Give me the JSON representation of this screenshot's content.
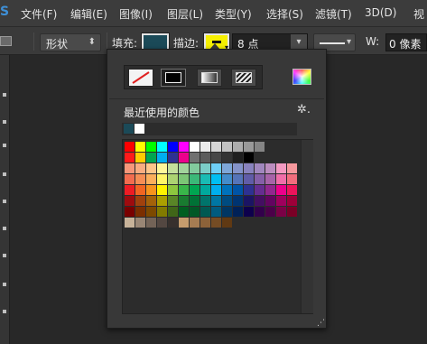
{
  "menubar": {
    "logo_glyph": "S",
    "items": [
      "文件(F)",
      "编辑(E)",
      "图像(I)",
      "图层(L)",
      "类型(Y)",
      "选择(S)",
      "滤镜(T)",
      "3D(D)",
      "视"
    ]
  },
  "options": {
    "shape_mode": "形状",
    "fill_label": "填充:",
    "fill_color": "#1b4a58",
    "stroke_label": "描边:",
    "stroke_color": "#f6f000",
    "stroke_size": "8 点",
    "width_label": "W:",
    "width_value": "0 像素"
  },
  "popup": {
    "type_icons": [
      "no-color-icon",
      "solid-color-icon",
      "gradient-icon",
      "pattern-icon"
    ],
    "active_type": "solid-color",
    "recent_title": "最近使用的颜色",
    "gear_glyph": "✲.",
    "grip_glyph": "⋰",
    "recent_colors": [
      "#1b4a58",
      "#ffffff"
    ],
    "swatch_rows": [
      [
        "#ff0000",
        "#ffff00",
        "#00ff00",
        "#00ffff",
        "#0000ff",
        "#ff00ff",
        "#ffffff",
        "#ebebeb",
        "#d6d6d6",
        "#c2c2c2",
        "#adadad",
        "#999999",
        "#858585"
      ],
      [
        "#ff1a1a",
        "#ffcc00",
        "#00a651",
        "#00aeef",
        "#2e3192",
        "#ec008c",
        "#707070",
        "#5c5c5c",
        "#474747",
        "#333333",
        "#1f1f1f",
        "#000000"
      ],
      [
        "#f7977a",
        "#f9ad81",
        "#fdc68a",
        "#fff79a",
        "#c4df9b",
        "#a2d39c",
        "#82ca9d",
        "#7bcdc8",
        "#6ecff6",
        "#7ea7d8",
        "#8493ca",
        "#8882be",
        "#a187be",
        "#bc8dbf",
        "#f49ac2",
        "#f6989d"
      ],
      [
        "#f26c4f",
        "#f68e55",
        "#fbaf5c",
        "#fff467",
        "#acd372",
        "#7cc576",
        "#3bb878",
        "#1abbb4",
        "#00bff3",
        "#438ccb",
        "#5574b9",
        "#605ca8",
        "#855fa8",
        "#a763a8",
        "#f06ea9",
        "#f26d7d"
      ],
      [
        "#ed1c24",
        "#f26522",
        "#f7941d",
        "#fff200",
        "#8dc63f",
        "#39b54a",
        "#00a651",
        "#00a99d",
        "#00aeef",
        "#0072bc",
        "#0054a6",
        "#2e3192",
        "#662d91",
        "#92278f",
        "#ec008c",
        "#ed145b"
      ],
      [
        "#9e0b0f",
        "#a0410d",
        "#a3620a",
        "#aba000",
        "#598527",
        "#197b30",
        "#007236",
        "#00746b",
        "#0076a3",
        "#004b80",
        "#003471",
        "#1b1464",
        "#440e62",
        "#630460",
        "#9e005d",
        "#9e0039"
      ],
      [
        "#790000",
        "#7b2e00",
        "#7d4900",
        "#827b00",
        "#406618",
        "#005e20",
        "#005826",
        "#005952",
        "#005b7f",
        "#003663",
        "#002157",
        "#0d004c",
        "#32004b",
        "#4b0049",
        "#7b0046",
        "#7a0026"
      ],
      [
        "#c7b299",
        "#998675",
        "#736357",
        "#534741",
        "#37302d",
        "#c69c6d",
        "#a67c52",
        "#8c6239",
        "#754c24",
        "#603913"
      ]
    ]
  }
}
